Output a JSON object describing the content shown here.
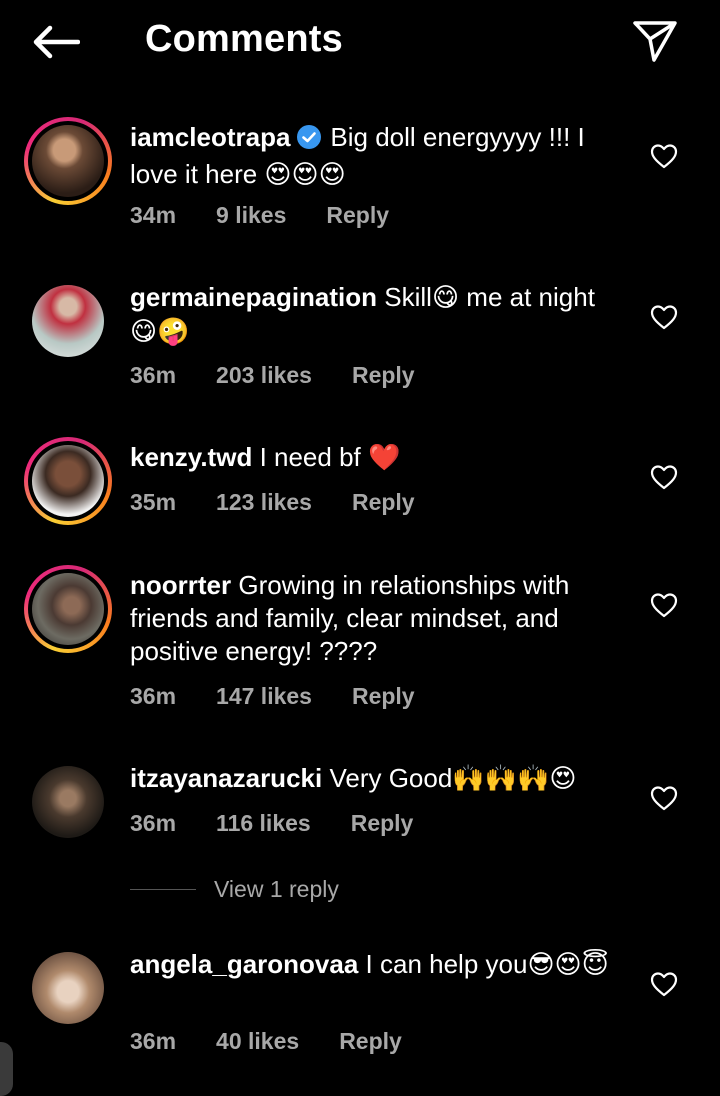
{
  "header": {
    "title": "Comments",
    "back_icon": "arrow-left-icon",
    "share_icon": "paper-plane-icon"
  },
  "comments": [
    {
      "username": "iamcleotrapa",
      "verified": true,
      "text": "Big doll energyyyy !!! I love it here",
      "emoji": "😍😍😍",
      "time": "34m",
      "likes": "9 likes",
      "reply": "Reply",
      "story_ring": true
    },
    {
      "username": "germainepagination",
      "verified": false,
      "text_a": "Skill",
      "emoji_a": "😋",
      "text_b": " me at night ",
      "emoji_b": "😋🤪",
      "time": "36m",
      "likes": "203 likes",
      "reply": "Reply",
      "story_ring": false
    },
    {
      "username": "kenzy.twd",
      "verified": false,
      "text": "I need bf",
      "emoji": "❤️",
      "time": "35m",
      "likes": "123 likes",
      "reply": "Reply",
      "story_ring": true
    },
    {
      "username": "noorrter",
      "verified": false,
      "text": "Growing in relationships with friends and family, clear mindset, and positive energy! ????",
      "time": "36m",
      "likes": "147 likes",
      "reply": "Reply",
      "story_ring": true
    },
    {
      "username": "itzayanazarucki",
      "verified": false,
      "text": "Very Good",
      "emoji": "🙌🙌🙌😍",
      "time": "36m",
      "likes": "116 likes",
      "reply": "Reply",
      "story_ring": false,
      "view_replies": "View 1 reply"
    },
    {
      "username": "angela_garonovaa",
      "verified": false,
      "text": "I can help you",
      "emoji": "😎😍😇",
      "time": "36m",
      "likes": "40 likes",
      "reply": "Reply",
      "story_ring": false
    }
  ],
  "colors": {
    "background": "#000000",
    "meta_text": "#a8a8a8",
    "verified_blue": "#3897f0",
    "heart_red": "#e0245e"
  }
}
